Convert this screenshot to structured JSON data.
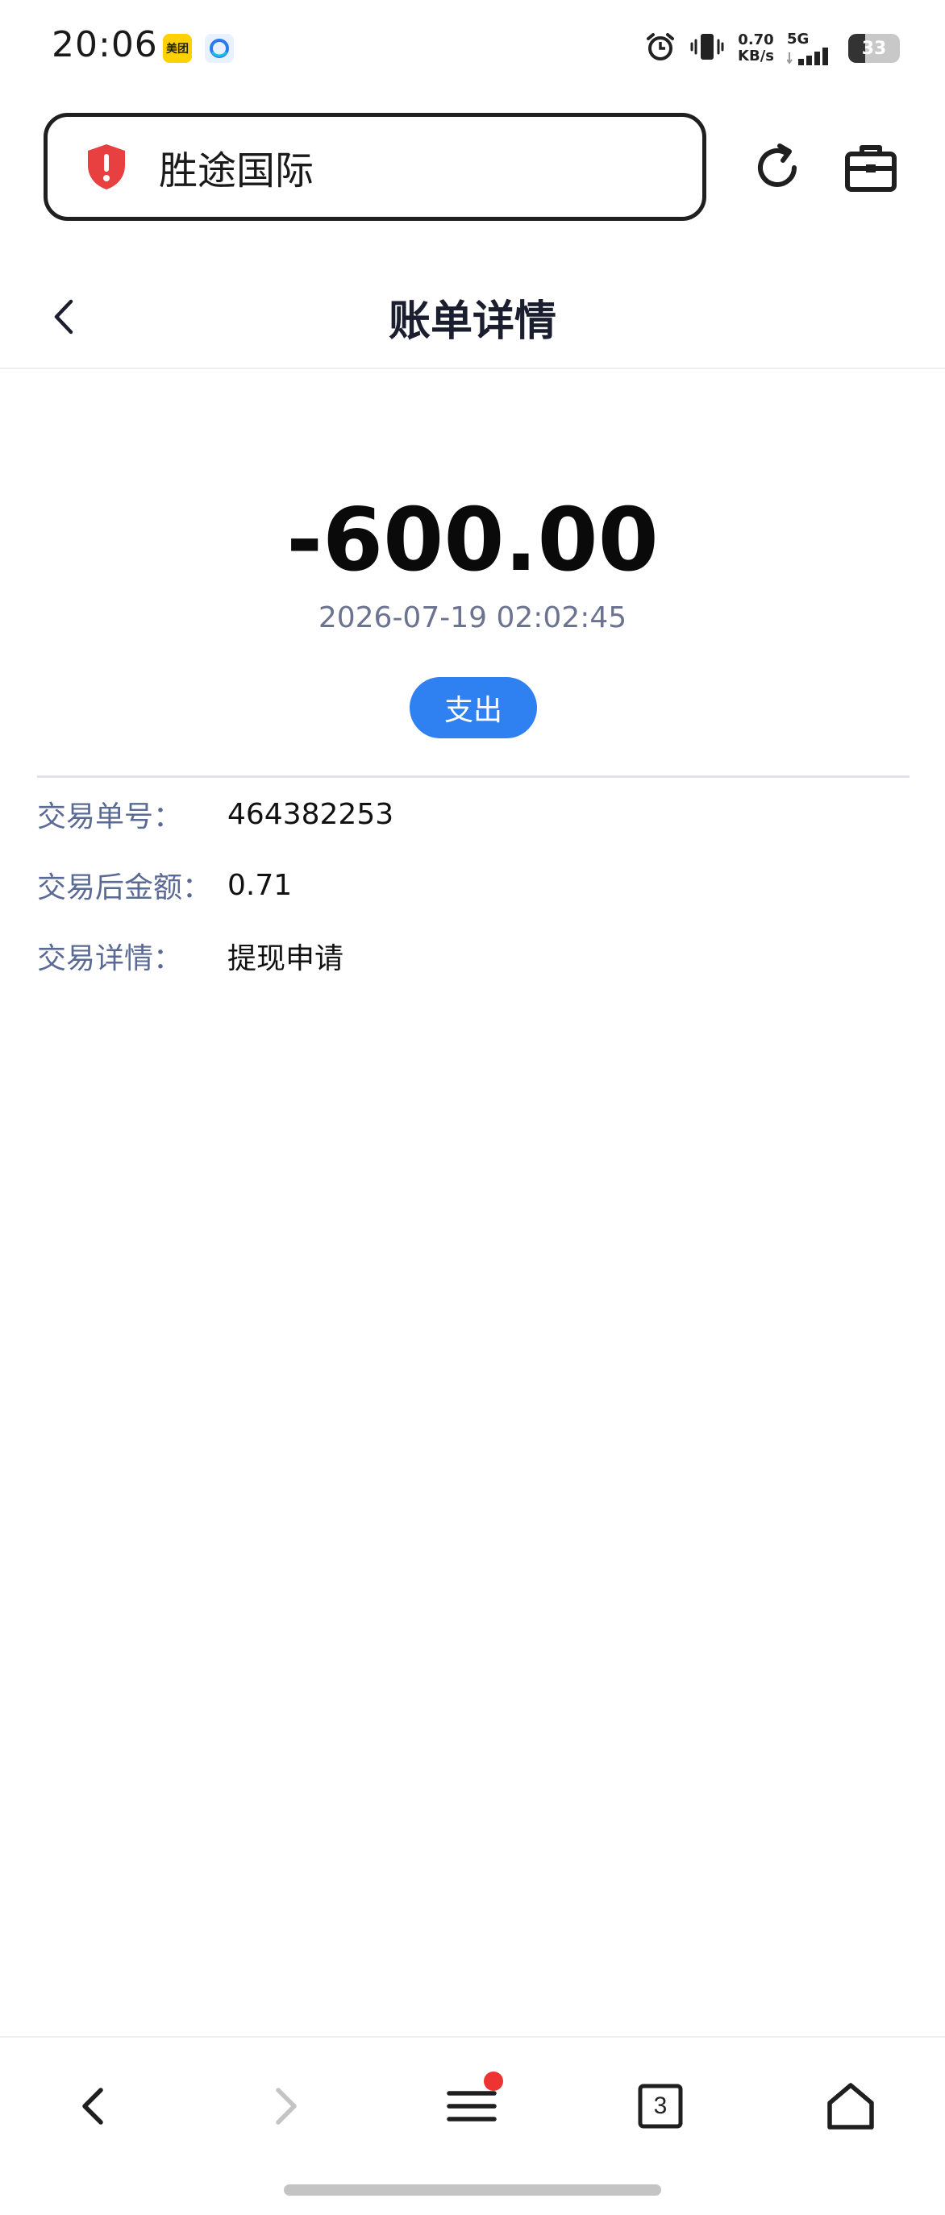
{
  "status_bar": {
    "time": "20:06",
    "meituan_badge": "美团",
    "net_speed_value": "0.70",
    "net_speed_unit": "KB/s",
    "network_type": "5G",
    "battery_level": "33",
    "battery_fraction": 0.33
  },
  "address_bar": {
    "site_name": "胜途国际",
    "shield_color": "#e84040"
  },
  "header": {
    "title": "账单详情"
  },
  "transaction": {
    "amount": "-600.00",
    "timestamp": "2026-07-19 02:02:45",
    "type_label": "支出",
    "type_color": "#2f80f0",
    "details": [
      {
        "label": "交易单号：",
        "value": "464382253"
      },
      {
        "label": "交易后金额：",
        "value": "0.71"
      },
      {
        "label": "交易详情：",
        "value": "提现申请"
      }
    ]
  },
  "bottom_nav": {
    "tab_count": "3",
    "icons": [
      "back-icon",
      "forward-icon",
      "menu-icon",
      "tabs-icon",
      "home-icon"
    ]
  }
}
